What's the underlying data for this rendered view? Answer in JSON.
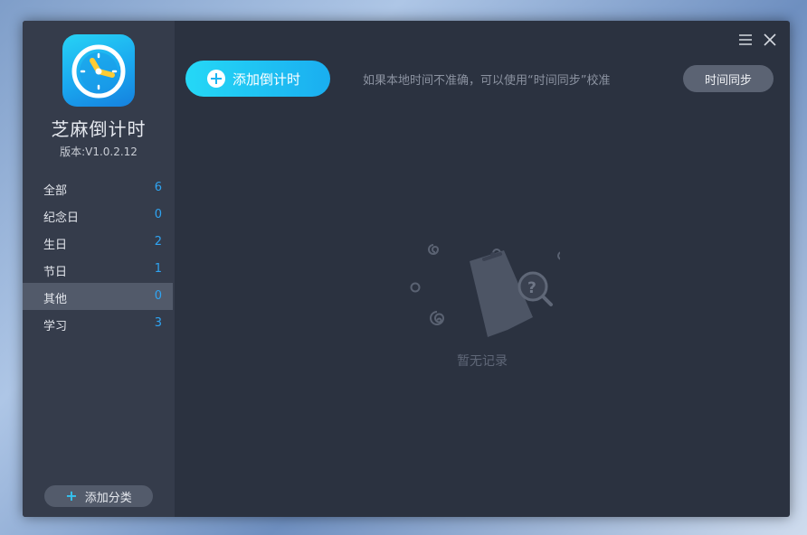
{
  "app": {
    "title": "芝麻倒计时",
    "version": "版本:V1.0.2.12",
    "logo_icon": "clock-icon"
  },
  "sidebar": {
    "categories": [
      {
        "label": "全部",
        "count": "6"
      },
      {
        "label": "纪念日",
        "count": "0"
      },
      {
        "label": "生日",
        "count": "2"
      },
      {
        "label": "节日",
        "count": "1"
      },
      {
        "label": "其他",
        "count": "0",
        "active": true
      },
      {
        "label": "学习",
        "count": "3"
      }
    ],
    "add_category_label": "添加分类"
  },
  "toolbar": {
    "add_countdown_label": "添加倒计时",
    "sync_hint": "如果本地时间不准确，可以使用“时间同步”校准",
    "sync_button_label": "时间同步"
  },
  "empty_state": {
    "text": "暂无记录",
    "icon": "empty-record-icon"
  },
  "colors": {
    "accent": "#1aaef0",
    "count": "#2fa4f2",
    "window_bg": "#2b3240",
    "sidebar_bg": "#353c4b",
    "active_item_bg": "#525a6a"
  }
}
